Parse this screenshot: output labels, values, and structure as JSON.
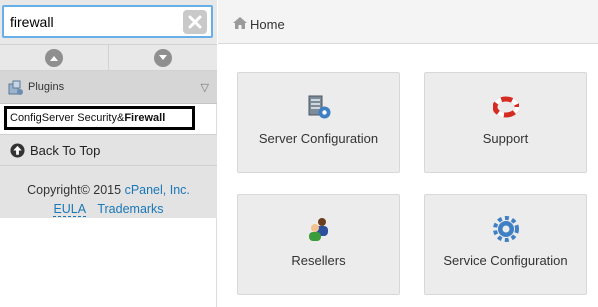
{
  "search": {
    "value": "firewall",
    "clear_icon": "close-icon"
  },
  "sidebar": {
    "scroll_up_icon": "chevron-up-icon",
    "scroll_down_icon": "chevron-down-icon",
    "plugins_section": {
      "label": "Plugins",
      "icon": "plugins-icon",
      "toggle": "▽"
    },
    "plugin_item": {
      "prefix": "ConfigServer Security&",
      "highlight": "Firewall"
    },
    "back_to_top": {
      "label": "Back To Top",
      "icon": "arrow-up-circle-icon"
    },
    "footer": {
      "copyright": "Copyright© 2015 ",
      "company": "cPanel, Inc.",
      "eula": "EULA",
      "trademarks": "Trademarks"
    }
  },
  "breadcrumb": {
    "home": "Home",
    "icon": "home-icon"
  },
  "tiles": [
    {
      "label": "Server Configuration",
      "icon": "server-gear-icon"
    },
    {
      "label": "Support",
      "icon": "lifebuoy-icon"
    },
    {
      "label": "Resellers",
      "icon": "users-icon"
    },
    {
      "label": "Service Configuration",
      "icon": "gear-icon"
    }
  ],
  "colors": {
    "link": "#1a77b8",
    "search_focus": "#66afe9",
    "tile_bg": "#ececec"
  }
}
